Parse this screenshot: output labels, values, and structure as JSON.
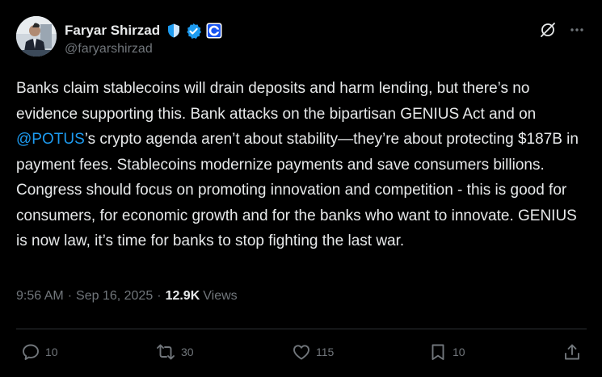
{
  "author": {
    "display_name": "Faryar Shirzad",
    "handle": "@faryarshirzad",
    "avatar_icon": "person-avatar",
    "badges": [
      "shield-badge-icon",
      "verified-badge-icon",
      "coinbase-affiliate-icon"
    ]
  },
  "header": {
    "grok_icon": "grok-icon",
    "more_icon": "more-horizontal-icon"
  },
  "post": {
    "text_before_mention": "Banks claim stablecoins will drain deposits and harm lending, but there’s no evidence supporting this. Bank attacks on the bipartisan GENIUS Act and on ",
    "mention": "@POTUS",
    "text_after_mention": "’s crypto agenda aren’t about stability—they’re about protecting $187B in payment fees. Stablecoins modernize payments and save consumers billions. Congress should focus on promoting innovation and competition - this is good for consumers, for economic growth and for the banks who want to innovate. GENIUS is now law, it’s time for banks to stop fighting the last war."
  },
  "meta": {
    "time": "9:56 AM",
    "date": "Sep 16, 2025",
    "separator": "·",
    "views_count": "12.9K",
    "views_label": "Views"
  },
  "actions": {
    "replies": "10",
    "reposts": "30",
    "likes": "115",
    "bookmarks": "10"
  },
  "colors": {
    "background": "#000000",
    "text": "#e7e9ea",
    "secondary": "#71767b",
    "accent": "#1d9bf0",
    "divider": "#2f3336"
  }
}
